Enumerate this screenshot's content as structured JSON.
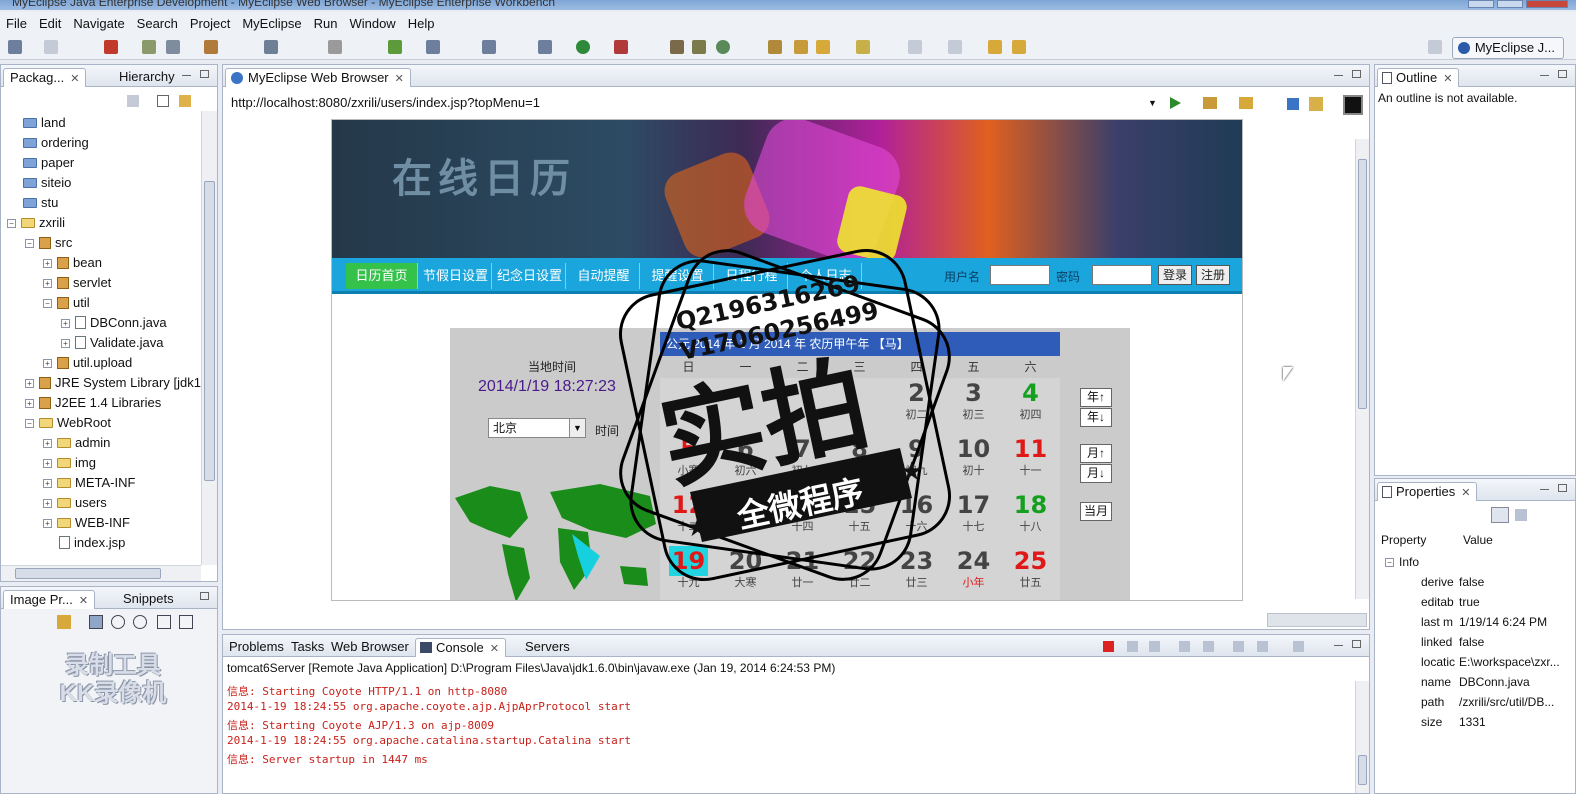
{
  "window": {
    "title": "MyEclipse Java Enterprise Development - MyEclipse Web Browser - MyEclipse Enterprise Workbench"
  },
  "menu": [
    "File",
    "Edit",
    "Navigate",
    "Search",
    "Project",
    "MyEclipse",
    "Run",
    "Window",
    "Help"
  ],
  "perspective": "MyEclipse J...",
  "explorer": {
    "tabs": [
      "Packag...",
      "Hierarchy"
    ],
    "items": [
      "land",
      "ordering",
      "paper",
      "siteio",
      "stu",
      "zxrili",
      "src",
      "bean",
      "servlet",
      "util",
      "DBConn.java",
      "Validate.java",
      "util.upload",
      "JRE System Library [jdk1",
      "J2EE 1.4 Libraries",
      "WebRoot",
      "admin",
      "img",
      "META-INF",
      "users",
      "WEB-INF",
      "index.jsp"
    ]
  },
  "imagepanel": {
    "tabs": [
      "Image Pr...",
      "Snippets"
    ],
    "watermark": [
      "录制工具",
      "KK录像机"
    ]
  },
  "browser": {
    "tab": "MyEclipse Web Browser",
    "url": "http://localhost:8080/zxrili/users/index.jsp?topMenu=1",
    "site": {
      "title": "在线日历",
      "nav": [
        "日历首页",
        "节假日设置",
        "纪念日设置",
        "自动提醒",
        "提醒设置",
        "日程行程",
        "个人日志"
      ],
      "login": {
        "user_label": "用户名",
        "pass_label": "密码",
        "login_btn": "登录",
        "register_btn": "注册"
      },
      "localtime_label": "当地时间",
      "localtime": "2014/1/19 18:27:23",
      "city": "北京",
      "time_label": "时间",
      "calendar": {
        "header": "公元 2014 年 1 月 2014 年 农历甲午年 【马】",
        "weekdays": [
          "日",
          "一",
          "二",
          "三",
          "四",
          "五",
          "六"
        ],
        "days": [
          {
            "d": "2",
            "l": "初二"
          },
          {
            "d": "3",
            "l": "初三"
          },
          {
            "d": "4",
            "l": "初四"
          },
          {
            "d": "5",
            "l": "小寒"
          },
          {
            "d": "6",
            "l": "初六"
          },
          {
            "d": "7",
            "l": "初七"
          },
          {
            "d": "8",
            "l": "腊八"
          },
          {
            "d": "9",
            "l": "初九"
          },
          {
            "d": "10",
            "l": "初十"
          },
          {
            "d": "11",
            "l": "十一"
          },
          {
            "d": "12",
            "l": "十二"
          },
          {
            "d": "13",
            "l": "十三"
          },
          {
            "d": "14",
            "l": "十四"
          },
          {
            "d": "15",
            "l": "十五"
          },
          {
            "d": "16",
            "l": "十六"
          },
          {
            "d": "17",
            "l": "十七"
          },
          {
            "d": "18",
            "l": "十八"
          },
          {
            "d": "19",
            "l": "十九"
          },
          {
            "d": "20",
            "l": "大寒"
          },
          {
            "d": "21",
            "l": "廿一"
          },
          {
            "d": "22",
            "l": "廿二"
          },
          {
            "d": "23",
            "l": "廿三"
          },
          {
            "d": "24",
            "l": "小年"
          },
          {
            "d": "25",
            "l": "廿五"
          }
        ],
        "buttons": [
          "年↑",
          "年↓",
          "月↑",
          "月↓",
          "当月"
        ]
      }
    }
  },
  "outline": {
    "tab": "Outline",
    "message": "An outline is not available."
  },
  "properties": {
    "tab": "Properties",
    "headers": [
      "Property",
      "Value"
    ],
    "group": "Info",
    "rows": [
      {
        "k": "derive",
        "v": "false"
      },
      {
        "k": "editab",
        "v": "true"
      },
      {
        "k": "last m",
        "v": "1/19/14 6:24 PM"
      },
      {
        "k": "linked",
        "v": "false"
      },
      {
        "k": "locatic",
        "v": "E:\\workspace\\zxr..."
      },
      {
        "k": "name",
        "v": "DBConn.java"
      },
      {
        "k": "path",
        "v": "/zxrili/src/util/DB..."
      },
      {
        "k": "size",
        "v": "1331"
      }
    ]
  },
  "console": {
    "tabs": [
      "Problems",
      "Tasks",
      "Web Browser",
      "Console",
      "Servers"
    ],
    "header": "tomcat6Server [Remote Java Application] D:\\Program Files\\Java\\jdk1.6.0\\bin\\javaw.exe (Jan 19, 2014 6:24:53 PM)",
    "lines": [
      "信息: Starting Coyote HTTP/1.1 on http-8080",
      "2014-1-19 18:24:55 org.apache.coyote.ajp.AjpAprProtocol start",
      "信息: Starting Coyote AJP/1.3 on ajp-8009",
      "2014-1-19 18:24:55 org.apache.catalina.startup.Catalina start",
      "信息: Server startup in 1447 ms"
    ]
  },
  "stamp": {
    "qq": "Q2196316269",
    "v": "V17060256499",
    "big": "实拍",
    "banner": "全微程序"
  }
}
